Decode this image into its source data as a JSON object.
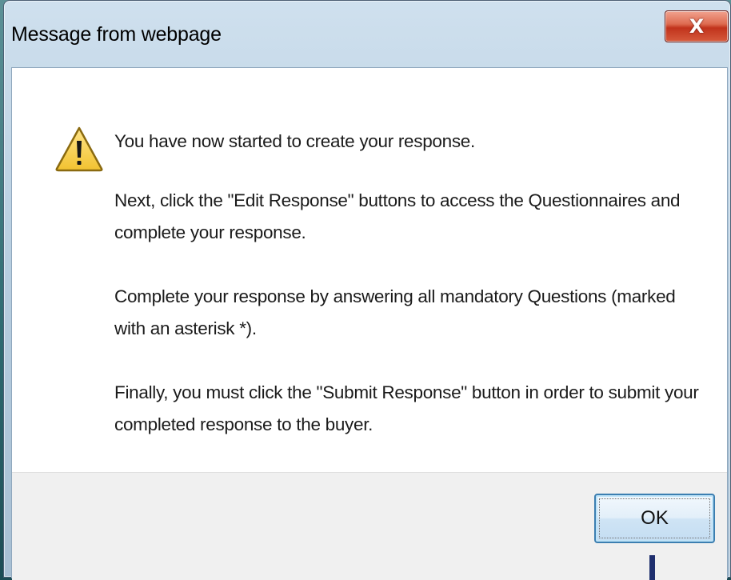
{
  "dialog": {
    "title": "Message from webpage",
    "close_label": "X",
    "icon": "warning-icon",
    "messages": [
      "You have now started to create your response.",
      "Next, click the \"Edit Response\" buttons to access the Questionnaires and complete your response.",
      "Complete your response by answering all mandatory Questions (marked with an asterisk *).",
      "Finally, you must click the \"Submit Response\" button in order to submit your completed response to the buyer."
    ],
    "ok_label": "OK"
  },
  "colors": {
    "close_button": "#c1331c",
    "ok_border": "#3c7fb1",
    "pointer": "#1f2f6e"
  }
}
